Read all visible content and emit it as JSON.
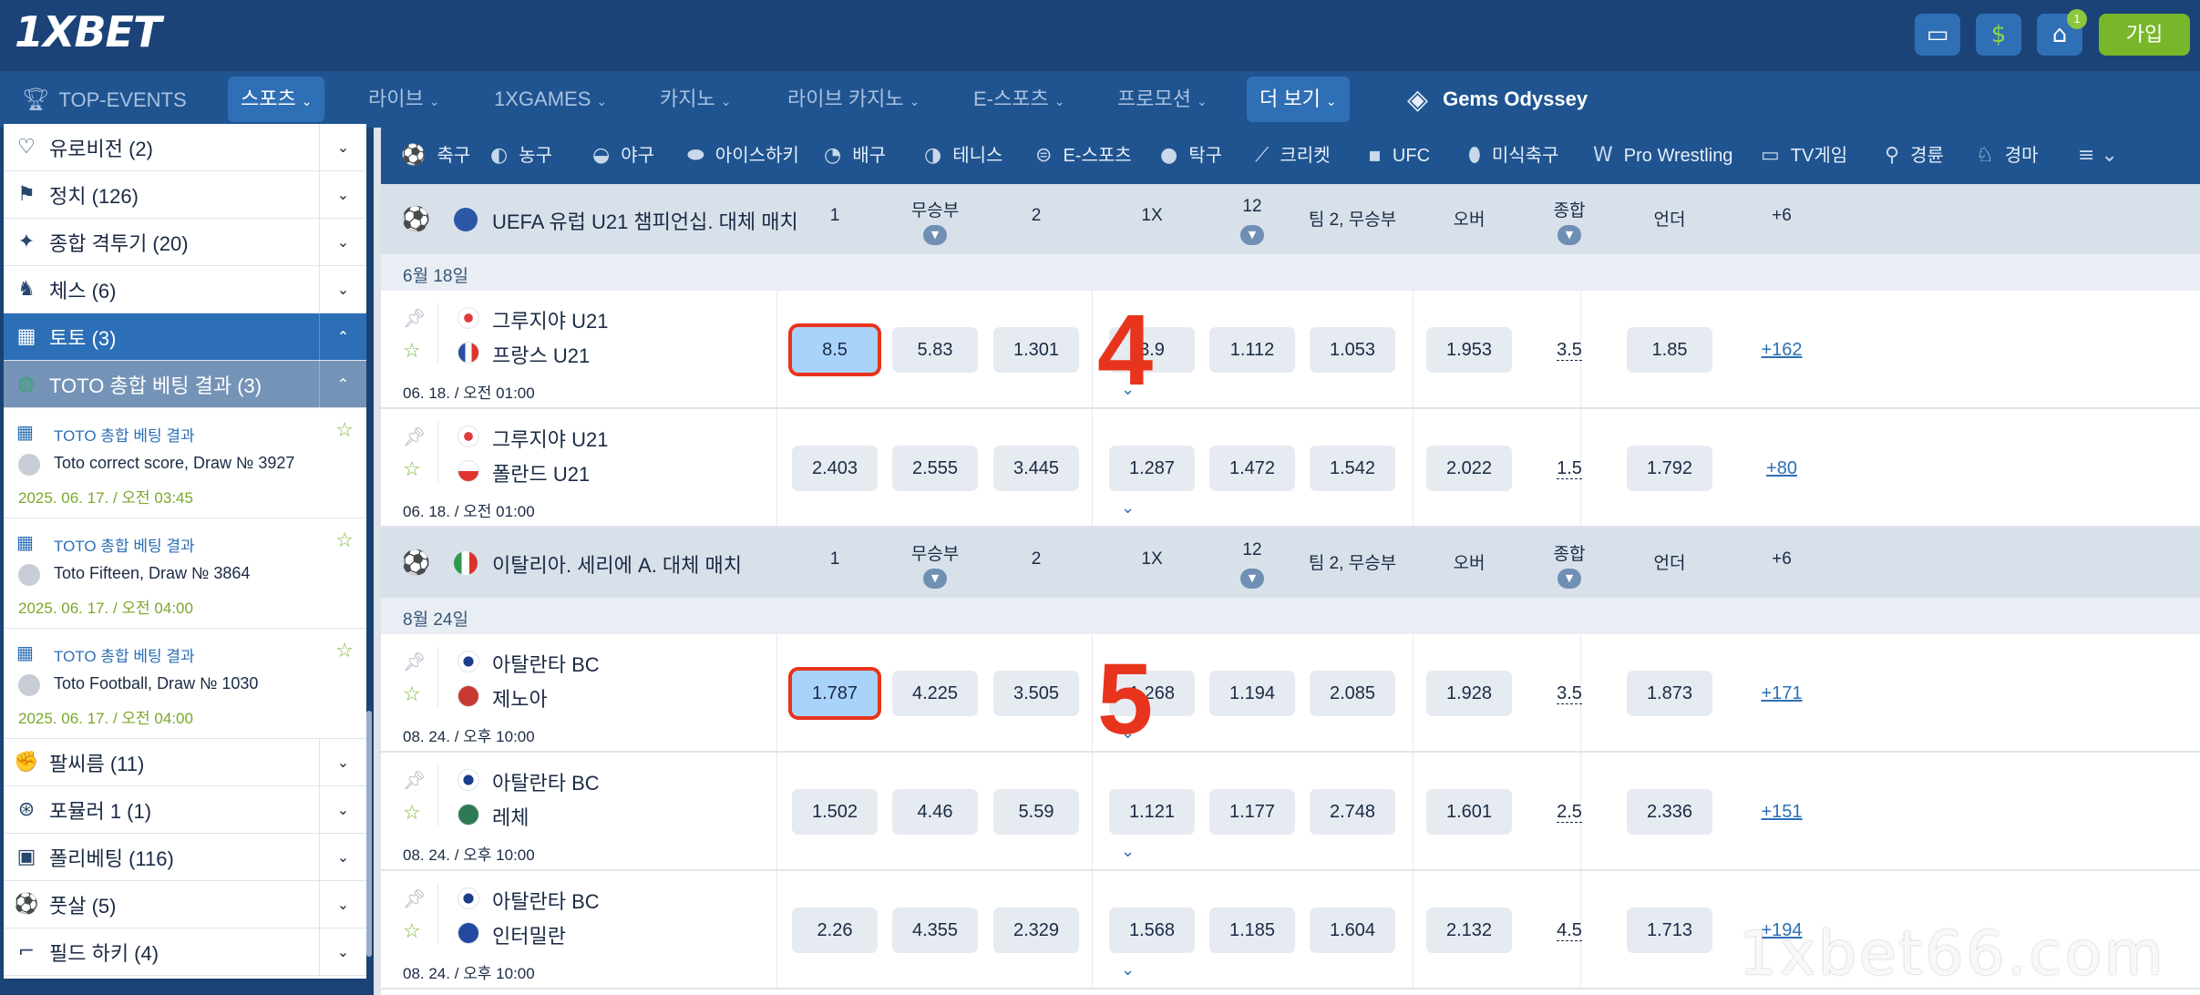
{
  "header": {
    "logo": "1XBET",
    "join_label": "가입",
    "gift_badge": "1"
  },
  "nav": {
    "top_events": "TOP-EVENTS",
    "sports": "스포츠",
    "live": "라이브",
    "xgames": "1XGAMES",
    "casino": "카지노",
    "live_casino": "라이브 카지노",
    "esports": "E-스포츠",
    "promotions": "프로모션",
    "more": "더 보기",
    "gems": "Gems Odyssey"
  },
  "sports_bar": [
    {
      "label": "축구",
      "icon": "soccer-ball-icon"
    },
    {
      "label": "농구",
      "icon": "basketball-icon"
    },
    {
      "label": "야구",
      "icon": "baseball-icon"
    },
    {
      "label": "아이스하키",
      "icon": "ice-hockey-icon"
    },
    {
      "label": "배구",
      "icon": "volleyball-icon"
    },
    {
      "label": "테니스",
      "icon": "tennis-icon"
    },
    {
      "label": "E-스포츠",
      "icon": "gamepad-icon"
    },
    {
      "label": "탁구",
      "icon": "table-tennis-icon"
    },
    {
      "label": "크리켓",
      "icon": "cricket-icon"
    },
    {
      "label": "UFC",
      "icon": "ufc-icon"
    },
    {
      "label": "미식축구",
      "icon": "american-football-icon"
    },
    {
      "label": "Pro Wrestling",
      "icon": "wrestling-icon"
    },
    {
      "label": "TV게임",
      "icon": "tv-icon"
    },
    {
      "label": "경륜",
      "icon": "bicycle-icon"
    },
    {
      "label": "경마",
      "icon": "horse-icon"
    }
  ],
  "sidebar": {
    "items_top": [
      {
        "label": "유로비전 (2)",
        "icon": "heart-icon"
      },
      {
        "label": "정치 (126)",
        "icon": "podium-icon"
      },
      {
        "label": "종합 격투기 (20)",
        "icon": "martial-arts-icon"
      },
      {
        "label": "체스 (6)",
        "icon": "chess-knight-icon"
      }
    ],
    "toto": {
      "label": "토토 (3)",
      "icon": "calendar-grid-icon"
    },
    "toto_sub": {
      "label": "TOTO 총합 베팅 결과 (3)",
      "icon": "globe-icon"
    },
    "results": [
      {
        "category": "TOTO 총합 베팅 결과",
        "title": "Toto correct score, Draw № 3927",
        "date": "2025. 06. 17. / 오전 03:45"
      },
      {
        "category": "TOTO 총합 베팅 결과",
        "title": "Toto Fifteen, Draw № 3864",
        "date": "2025. 06. 17. / 오전 04:00"
      },
      {
        "category": "TOTO 총합 베팅 결과",
        "title": "Toto Football, Draw № 1030",
        "date": "2025. 06. 17. / 오전 04:00"
      }
    ],
    "items_bottom": [
      {
        "label": "팔씨름 (11)",
        "icon": "arm-wrestling-icon"
      },
      {
        "label": "포뮬러 1 (1)",
        "icon": "steering-wheel-icon"
      },
      {
        "label": "폴리베팅 (116)",
        "icon": "polybet-icon"
      },
      {
        "label": "풋살 (5)",
        "icon": "futsal-ball-icon"
      },
      {
        "label": "필드 하키 (4)",
        "icon": "field-hockey-icon"
      }
    ]
  },
  "columns": [
    "1",
    "무승부",
    "2",
    "1X",
    "12",
    "팀 2, 무승부",
    "오버",
    "종합",
    "언더",
    "+6"
  ],
  "leagues": [
    {
      "name": "UEFA 유럽 U21 챔피언십. 대체 매치",
      "date_group": "6월 18일",
      "matches": [
        {
          "team1": "그루지야 U21",
          "team2": "프랑스 U21",
          "time": "06. 18. / 오전 01:00",
          "odds": [
            "8.5",
            "5.83",
            "1.301",
            "3.9",
            "1.112",
            "1.053",
            "1.953",
            "3.5",
            "1.85"
          ],
          "more": "+162",
          "highlight": true
        },
        {
          "team1": "그루지야 U21",
          "team2": "폴란드 U21",
          "time": "06. 18. / 오전 01:00",
          "odds": [
            "2.403",
            "2.555",
            "3.445",
            "1.287",
            "1.472",
            "1.542",
            "2.022",
            "1.5",
            "1.792"
          ],
          "more": "+80",
          "highlight": false
        }
      ]
    },
    {
      "name": "이탈리아. 세리에 A. 대체 매치",
      "date_group": "8월 24일",
      "matches": [
        {
          "team1": "아탈란타 BC",
          "team2": "제노아",
          "time": "08. 24. / 오후 10:00",
          "odds": [
            "1.787",
            "4.225",
            "3.505",
            "1.268",
            "1.194",
            "2.085",
            "1.928",
            "3.5",
            "1.873"
          ],
          "more": "+171",
          "highlight": true
        },
        {
          "team1": "아탈란타 BC",
          "team2": "레체",
          "time": "08. 24. / 오후 10:00",
          "odds": [
            "1.502",
            "4.46",
            "5.59",
            "1.121",
            "1.177",
            "2.748",
            "1.601",
            "2.5",
            "2.336"
          ],
          "more": "+151",
          "highlight": false
        },
        {
          "team1": "아탈란타 BC",
          "team2": "인터밀란",
          "time": "08. 24. / 오후 10:00",
          "odds": [
            "2.26",
            "4.355",
            "2.329",
            "1.568",
            "1.185",
            "1.604",
            "2.132",
            "4.5",
            "1.713"
          ],
          "more": "+194",
          "highlight": false
        }
      ]
    }
  ],
  "annotations": [
    "4",
    "5"
  ],
  "watermark": "1xbet66.com",
  "colors": {
    "header": "#1b4377",
    "nav": "#1f5490",
    "accent": "#2f6fb5",
    "join": "#78b72a",
    "highlight_outline": "#e8341c",
    "highlight_fill": "#a9d3fb"
  }
}
